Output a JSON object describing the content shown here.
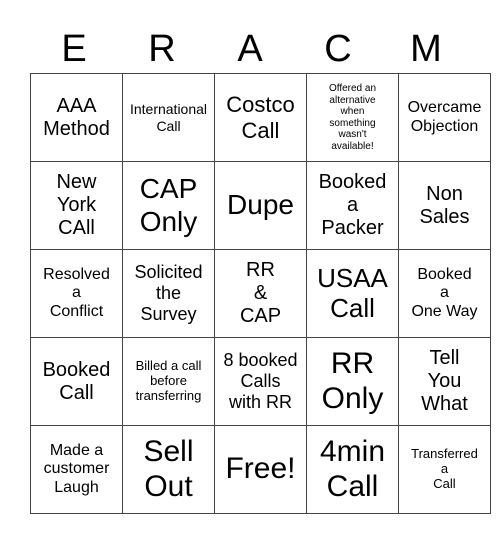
{
  "header": [
    "E",
    "R",
    "A",
    "C",
    "M"
  ],
  "cells": [
    [
      {
        "t": "AAA\nMethod",
        "s": 20
      },
      {
        "t": "International\nCall",
        "s": 14
      },
      {
        "t": "Costco\nCall",
        "s": 22
      },
      {
        "t": "Offered an\nalternative\nwhen\nsomething\nwasn't\navailable!",
        "s": 10
      },
      {
        "t": "Overcame\nObjection",
        "s": 16
      }
    ],
    [
      {
        "t": "New\nYork\nCAll",
        "s": 20
      },
      {
        "t": "CAP\nOnly",
        "s": 28
      },
      {
        "t": "Dupe",
        "s": 28
      },
      {
        "t": "Booked\na\nPacker",
        "s": 20
      },
      {
        "t": "Non\nSales",
        "s": 20
      }
    ],
    [
      {
        "t": "Resolved\na\nConflict",
        "s": 16
      },
      {
        "t": "Solicited\nthe\nSurvey",
        "s": 18
      },
      {
        "t": "RR\n&\nCAP",
        "s": 20
      },
      {
        "t": "USAA\nCall",
        "s": 26
      },
      {
        "t": "Booked\na\nOne Way",
        "s": 16
      }
    ],
    [
      {
        "t": "Booked\nCall",
        "s": 20
      },
      {
        "t": "Billed a call\nbefore\ntransferring",
        "s": 13
      },
      {
        "t": "8 booked\nCalls\nwith RR",
        "s": 18
      },
      {
        "t": "RR\nOnly",
        "s": 30
      },
      {
        "t": "Tell\nYou\nWhat",
        "s": 20
      }
    ],
    [
      {
        "t": "Made a\ncustomer\nLaugh",
        "s": 16
      },
      {
        "t": "Sell\nOut",
        "s": 30
      },
      {
        "t": "Free!",
        "s": 30
      },
      {
        "t": "4min\nCall",
        "s": 30
      },
      {
        "t": "Transferred\na\nCall",
        "s": 13
      }
    ]
  ]
}
